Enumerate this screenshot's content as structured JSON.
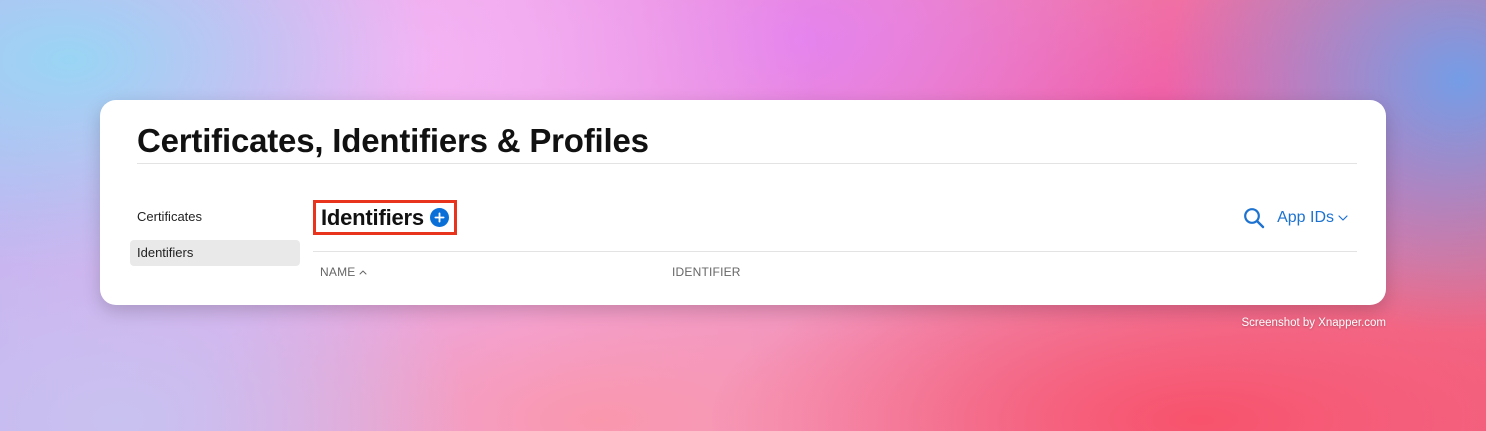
{
  "page": {
    "title": "Certificates, Identifiers & Profiles"
  },
  "sidebar": {
    "items": [
      {
        "label": "Certificates",
        "active": false
      },
      {
        "label": "Identifiers",
        "active": true
      }
    ]
  },
  "section": {
    "title": "Identifiers",
    "add_icon": "plus-circle-icon",
    "search_icon": "search-icon",
    "filter_label": "App IDs",
    "filter_icon": "chevron-down-icon"
  },
  "table": {
    "columns": [
      {
        "label": "NAME",
        "sort": "ascending"
      },
      {
        "label": "IDENTIFIER"
      }
    ],
    "rows": []
  },
  "watermark": "Screenshot by Xnapper.com",
  "colors": {
    "accent": "#1d72d0",
    "add_button": "#0a70d8",
    "highlight_border": "#e8341c",
    "active_item_bg": "#e9e9e9"
  }
}
